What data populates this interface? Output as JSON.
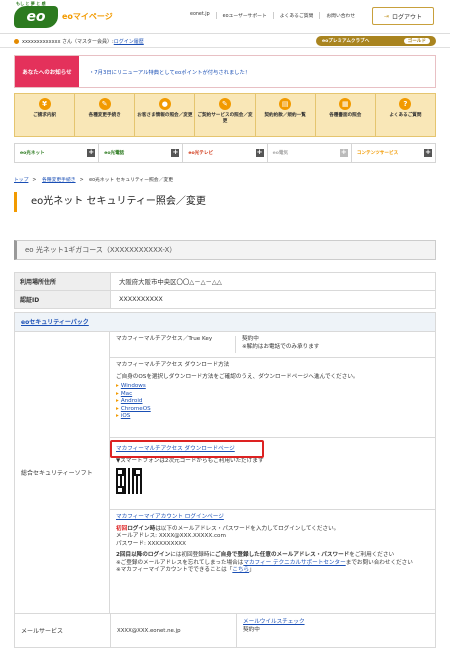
{
  "header": {
    "logo_tag": "もし と 夢 と 感",
    "logo": "eo",
    "site_name": "eoマイページ",
    "nav": [
      "eonet.jp",
      "eoユーザーサポート",
      "よくあるご質問",
      "お問い合わせ"
    ],
    "login": "ログアウト"
  },
  "user": {
    "text": "xxxxxxxxxxxxx さん（マスター会員）:",
    "history": "ログイン履歴",
    "premium": "eoプレミアムクラブへ",
    "rank": "ゴールド"
  },
  "notice": {
    "tag": "あなたへのお知らせ",
    "msg": "・7月3日にリニューアル特典としてeoポイントが付与されました！"
  },
  "menu": [
    {
      "icon": "¥",
      "label": "ご請求内訳"
    },
    {
      "icon": "✎",
      "label": "各種変更手続き"
    },
    {
      "icon": "●",
      "label": "お客さま情報の照会／変更"
    },
    {
      "icon": "✎",
      "label": "ご契約サービスの照会／変更"
    },
    {
      "icon": "▤",
      "label": "契約約款／規約一覧"
    },
    {
      "icon": "▦",
      "label": "各種書面の照会"
    },
    {
      "icon": "?",
      "label": "よくあるご質問"
    }
  ],
  "services": [
    {
      "label": "eo光ネット",
      "color": "#2c7a1f"
    },
    {
      "label": "eo光電話",
      "color": "#2c7a1f"
    },
    {
      "label": "eo光テレビ",
      "color": "#d13a1a"
    },
    {
      "label": "eo電気",
      "color": "#aaa"
    },
    {
      "label": "コンテンツサービス",
      "color": "#f29a00"
    }
  ],
  "breadcrumb": [
    "トップ",
    "各種変更手続き",
    "eo光ネット セキュリティー照会／変更"
  ],
  "page_title": "eo光ネット セキュリティー照会／変更",
  "course": "eo 光ネット1ギガコース（XXXXXXXXXXX-X）",
  "info": [
    {
      "label": "利用場所住所",
      "value": "大阪府大阪市中央区〇〇△－△－△△"
    },
    {
      "label": "認証ID",
      "value": "XXXXXXXXXX"
    }
  ],
  "security": {
    "header": "eoセキュリティーパック",
    "left_label": "総合セキュリティーソフト",
    "product": "マカフィーマルチアクセス／True Key",
    "status": "契約中",
    "status_note": "※解約はお電話でのみ承ります",
    "dl_title": "マカフィーマルチアクセス ダウンロード方法",
    "dl_desc": "ご自身のOSを選択しダウンロード方法をご確認のうえ、ダウンロードページへ進んでください。",
    "os": [
      "Windows",
      "Mac",
      "Android",
      "ChromeOS",
      "iOS"
    ],
    "dl_link": "マカフィーマルチアクセス ダウンロードページ",
    "sp_note": "▼スマートフォンは2次元コードからもご利用いただけます",
    "acct_link": "マカフィーマイアカウント ログインページ",
    "first_label": "初回",
    "first_rest": "ログイン時",
    "first_text": "は以下のメールアドレス・パスワードを入力してログインしてください。",
    "mail_line": "メールアドレス: XXXX@XXX.XXXXX.com",
    "pass_line": "パスワード: XXXXXXXXXX",
    "second_text": "2回目以降のログイン",
    "second_rest": "には初回登録時に",
    "second_bold": "ご自身で登録した任意のメールアドレス・パスワード",
    "second_end": "をご利用ください",
    "forget": "※ご登録のメールアドレスを忘れてしまった場合は",
    "support_link": "マカフィー テクニカルサポートセンター",
    "forget_end": "までお問い合わせください",
    "cando": "※マカフィーマイアカウントでできることは「",
    "cando_link": "こちら",
    "cando_end": "」"
  },
  "mail": {
    "label": "メールサービス",
    "address": "XXXX@XXX.eonet.ne.jp",
    "virus": "メールウイルスチェック",
    "status": "契約中"
  }
}
